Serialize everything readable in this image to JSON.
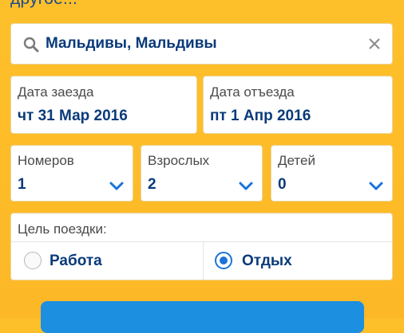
{
  "header": {
    "text": "другое..."
  },
  "search": {
    "value": "Мальдивы, Мальдивы",
    "icon": "search-icon",
    "clear_icon": "close-icon"
  },
  "dates": {
    "checkin": {
      "label": "Дата заезда",
      "value": "чт 31 Мар 2016"
    },
    "checkout": {
      "label": "Дата отъезда",
      "value": "пт 1 Апр 2016"
    }
  },
  "selectors": {
    "rooms": {
      "label": "Номеров",
      "value": "1"
    },
    "adults": {
      "label": "Взрослых",
      "value": "2"
    },
    "children": {
      "label": "Детей",
      "value": "0"
    }
  },
  "purpose": {
    "label": "Цель поездки:",
    "options": [
      {
        "label": "Работа",
        "selected": false
      },
      {
        "label": "Отдых",
        "selected": true
      }
    ]
  },
  "colors": {
    "accent": "#1a73d9",
    "text_primary": "#0a3a7a",
    "background": "#fec02a",
    "button": "#1d8fe1"
  }
}
